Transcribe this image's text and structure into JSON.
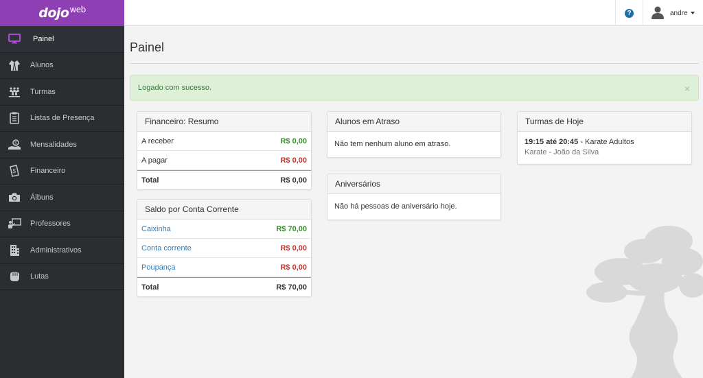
{
  "logo": {
    "text": "dojo",
    "sup": "web"
  },
  "sidebar": {
    "items": [
      {
        "label": "Painel",
        "icon": "monitor-icon"
      },
      {
        "label": "Alunos",
        "icon": "uniform-icon"
      },
      {
        "label": "Turmas",
        "icon": "group-icon"
      },
      {
        "label": "Listas de Presença",
        "icon": "clipboard-icon"
      },
      {
        "label": "Mensalidades",
        "icon": "payment-icon"
      },
      {
        "label": "Financeiro",
        "icon": "money-icon"
      },
      {
        "label": "Álbuns",
        "icon": "camera-icon"
      },
      {
        "label": "Professores",
        "icon": "teacher-icon"
      },
      {
        "label": "Administrativos",
        "icon": "building-icon"
      },
      {
        "label": "Lutas",
        "icon": "fist-icon"
      }
    ]
  },
  "topbar": {
    "help": "?",
    "user": "andre"
  },
  "page": {
    "title": "Painel"
  },
  "alert": {
    "message": "Logado com sucesso.",
    "close": "×"
  },
  "financeiro": {
    "title": "Financeiro: Resumo",
    "rows": [
      {
        "label": "A receber",
        "value": "R$ 0,00"
      },
      {
        "label": "A pagar",
        "value": "R$ 0,00"
      }
    ],
    "total": {
      "label": "Total",
      "value": "R$ 0,00"
    }
  },
  "saldo": {
    "title": "Saldo por Conta Corrente",
    "rows": [
      {
        "label": "Caixinha",
        "value": "R$ 70,00"
      },
      {
        "label": "Conta corrente",
        "value": "R$ 0,00"
      },
      {
        "label": "Poupança",
        "value": "R$ 0,00"
      }
    ],
    "total": {
      "label": "Total",
      "value": "R$ 70,00"
    }
  },
  "atraso": {
    "title": "Alunos em Atraso",
    "message": "Não tem nenhum aluno em atraso."
  },
  "aniversarios": {
    "title": "Aniversários",
    "message": "Não há pessoas de aniversário hoje."
  },
  "turmas": {
    "title": "Turmas de Hoje",
    "time": "19:15 até 20:45",
    "name": " - Karate Adultos",
    "detail": "Karate - João da Silva"
  },
  "colors": {
    "brand": "#8e3fb3",
    "sidebar": "#2b2d31",
    "positive": "#3c8b31",
    "negative": "#c0392b",
    "link": "#337ab7"
  }
}
